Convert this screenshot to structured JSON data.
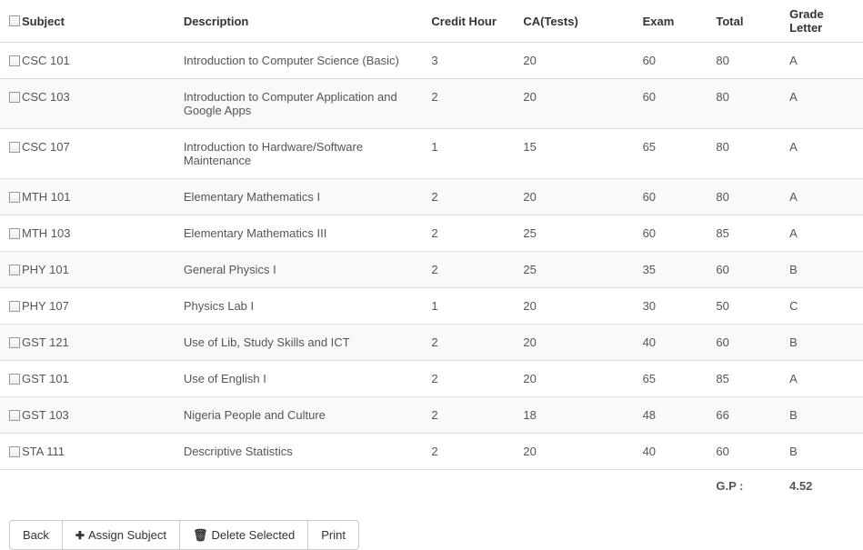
{
  "headers": {
    "subject": "Subject",
    "description": "Description",
    "credit_hour": "Credit Hour",
    "ca": "CA(Tests)",
    "exam": "Exam",
    "total": "Total",
    "grade": "Grade Letter"
  },
  "rows": [
    {
      "subject": "CSC 101",
      "description": "Introduction to Computer Science (Basic)",
      "credit_hour": "3",
      "ca": "20",
      "exam": "60",
      "total": "80",
      "grade": "A"
    },
    {
      "subject": "CSC 103",
      "description": "Introduction to Computer Application and Google Apps",
      "credit_hour": "2",
      "ca": "20",
      "exam": "60",
      "total": "80",
      "grade": "A"
    },
    {
      "subject": "CSC 107",
      "description": "Introduction to Hardware/Software Maintenance",
      "credit_hour": "1",
      "ca": "15",
      "exam": "65",
      "total": "80",
      "grade": "A"
    },
    {
      "subject": "MTH 101",
      "description": "Elementary Mathematics I",
      "credit_hour": "2",
      "ca": "20",
      "exam": "60",
      "total": "80",
      "grade": "A"
    },
    {
      "subject": "MTH 103",
      "description": "Elementary Mathematics III",
      "credit_hour": "2",
      "ca": "25",
      "exam": "60",
      "total": "85",
      "grade": "A"
    },
    {
      "subject": "PHY 101",
      "description": "General Physics I",
      "credit_hour": "2",
      "ca": "25",
      "exam": "35",
      "total": "60",
      "grade": "B"
    },
    {
      "subject": "PHY 107",
      "description": "Physics Lab I",
      "credit_hour": "1",
      "ca": "20",
      "exam": "30",
      "total": "50",
      "grade": "C"
    },
    {
      "subject": "GST 121",
      "description": "Use of Lib, Study Skills and ICT",
      "credit_hour": "2",
      "ca": "20",
      "exam": "40",
      "total": "60",
      "grade": "B"
    },
    {
      "subject": "GST 101",
      "description": "Use of English I",
      "credit_hour": "2",
      "ca": "20",
      "exam": "65",
      "total": "85",
      "grade": "A"
    },
    {
      "subject": "GST 103",
      "description": "Nigeria People and Culture",
      "credit_hour": "2",
      "ca": "18",
      "exam": "48",
      "total": "66",
      "grade": "B"
    },
    {
      "subject": "STA 111",
      "description": "Descriptive Statistics",
      "credit_hour": "2",
      "ca": "20",
      "exam": "40",
      "total": "60",
      "grade": "B"
    }
  ],
  "gp": {
    "label": "G.P :",
    "value": "4.52"
  },
  "buttons": {
    "back": "Back",
    "assign": "Assign Subject",
    "delete": "Delete Selected",
    "print": "Print"
  }
}
